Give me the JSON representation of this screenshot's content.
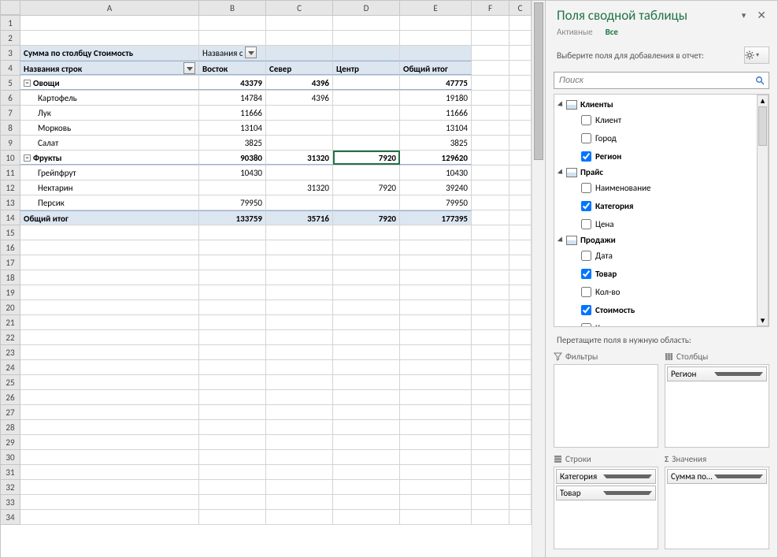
{
  "cols": [
    "A",
    "B",
    "C",
    "D",
    "E",
    "F",
    "C"
  ],
  "row_count": 34,
  "pivot": {
    "title": "Сумма по столбцу Стоимость",
    "col_label": "Названия с",
    "row_label": "Названия строк",
    "cols": [
      "Восток",
      "Север",
      "Центр",
      "Общий итог"
    ],
    "groups": [
      {
        "name": "Овощи",
        "totals": [
          "43379",
          "4396",
          "",
          "47775"
        ],
        "items": [
          {
            "name": "Картофель",
            "v": [
              "14784",
              "4396",
              "",
              "19180"
            ]
          },
          {
            "name": "Лук",
            "v": [
              "11666",
              "",
              "",
              "11666"
            ]
          },
          {
            "name": "Морковь",
            "v": [
              "13104",
              "",
              "",
              "13104"
            ]
          },
          {
            "name": "Салат",
            "v": [
              "3825",
              "",
              "",
              "3825"
            ]
          }
        ]
      },
      {
        "name": "Фрукты",
        "totals": [
          "90380",
          "31320",
          "7920",
          "129620"
        ],
        "items": [
          {
            "name": "Грейпфрут",
            "v": [
              "10430",
              "",
              "",
              "10430"
            ]
          },
          {
            "name": "Нектарин",
            "v": [
              "",
              "31320",
              "7920",
              "39240"
            ]
          },
          {
            "name": "Персик",
            "v": [
              "79950",
              "",
              "",
              "79950"
            ]
          }
        ]
      }
    ],
    "grand": {
      "name": "Общий итог",
      "v": [
        "133759",
        "35716",
        "7920",
        "177395"
      ]
    }
  },
  "selected_cell": "D10",
  "pane": {
    "title": "Поля сводной таблицы",
    "tab_active": "Активные",
    "tab_all": "Все",
    "desc": "Выберите поля для добавления в отчет:",
    "search_placeholder": "Поиск",
    "tables": [
      {
        "name": "Клиенты",
        "fields": [
          {
            "name": "Клиент",
            "checked": false
          },
          {
            "name": "Город",
            "checked": false
          },
          {
            "name": "Регион",
            "checked": true
          }
        ]
      },
      {
        "name": "Прайс",
        "fields": [
          {
            "name": "Наименование",
            "checked": false
          },
          {
            "name": "Категория",
            "checked": true
          },
          {
            "name": "Цена",
            "checked": false
          }
        ]
      },
      {
        "name": "Продажи",
        "fields": [
          {
            "name": "Дата",
            "checked": false
          },
          {
            "name": "Товар",
            "checked": true
          },
          {
            "name": "Кол-во",
            "checked": false
          },
          {
            "name": "Стоимость",
            "checked": true
          },
          {
            "name": "Клиент",
            "checked": false
          }
        ]
      }
    ],
    "drag_desc": "Перетащите поля в нужную область:",
    "areas": {
      "filters": {
        "label": "Фильтры",
        "items": []
      },
      "columns": {
        "label": "Столбцы",
        "items": [
          "Регион"
        ]
      },
      "rows": {
        "label": "Строки",
        "items": [
          "Категория",
          "Товар"
        ]
      },
      "values": {
        "label": "Значения",
        "items": [
          "Сумма по столбц..."
        ]
      }
    }
  }
}
